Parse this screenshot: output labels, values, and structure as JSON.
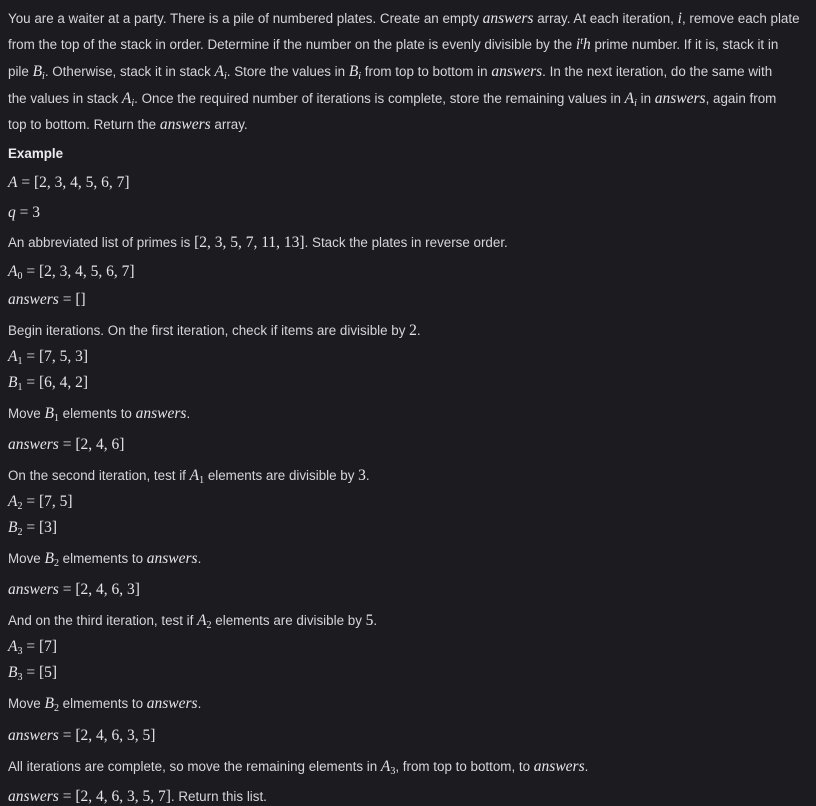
{
  "intro": {
    "line1": "You are a waiter at a party. There is a pile of numbered plates. Create an empty answers array. At each iteration, i, remove each plate",
    "line2": "from the top of the stack in order. Determine if the number on the plate is evenly divisible by the ith prime number. If it is, stack it in",
    "line3": "pile Bi. Otherwise, stack it in stack Ai. Store the values in Bi from top to bottom in answers. In the next iteration, do the same with",
    "line4": "the values in stack Ai. Once the required number of iterations is complete, store the remaining values in Ai in answers, again from",
    "line5": "top to bottom. Return the answers array."
  },
  "example_heading": "Example",
  "lines": {
    "a_def": "A = [2, 3, 4, 5, 6, 7]",
    "q_def": "q = 3",
    "primes_text": "An abbreviated list of primes is [2, 3, 5, 7, 11, 13]. Stack the plates in reverse order.",
    "a0": "A0 = [2, 3, 4, 5, 6, 7]",
    "answers0": "answers = []",
    "begin": "Begin iterations. On the first iteration, check if items are divisible by 2.",
    "a1": "A1 = [7, 5, 3]",
    "b1": "B1 = [6, 4, 2]",
    "move1": "Move B1 elements to answers.",
    "answers1": "answers = [2, 4, 6]",
    "second": "On the second iteration, test if A1 elements are divisible by 3.",
    "a2": "A2 = [7, 5]",
    "b2": "B2 = [3]",
    "move2": "Move B2 elmements to answers.",
    "answers2": "answers = [2, 4, 6, 3]",
    "third": "And on the third iteration, test if A2 elements are divisible by 5.",
    "a3": "A3 = [7]",
    "b3": "B3 = [5]",
    "move3": "Move B2 elmements to answers.",
    "answers3": "answers = [2, 4, 6, 3, 5]",
    "complete": "All iterations are complete, so move the remaining elements in A3, from top to bottom, to answers.",
    "final": "answers = [2, 4, 6, 3, 5, 7]. Return this list."
  }
}
